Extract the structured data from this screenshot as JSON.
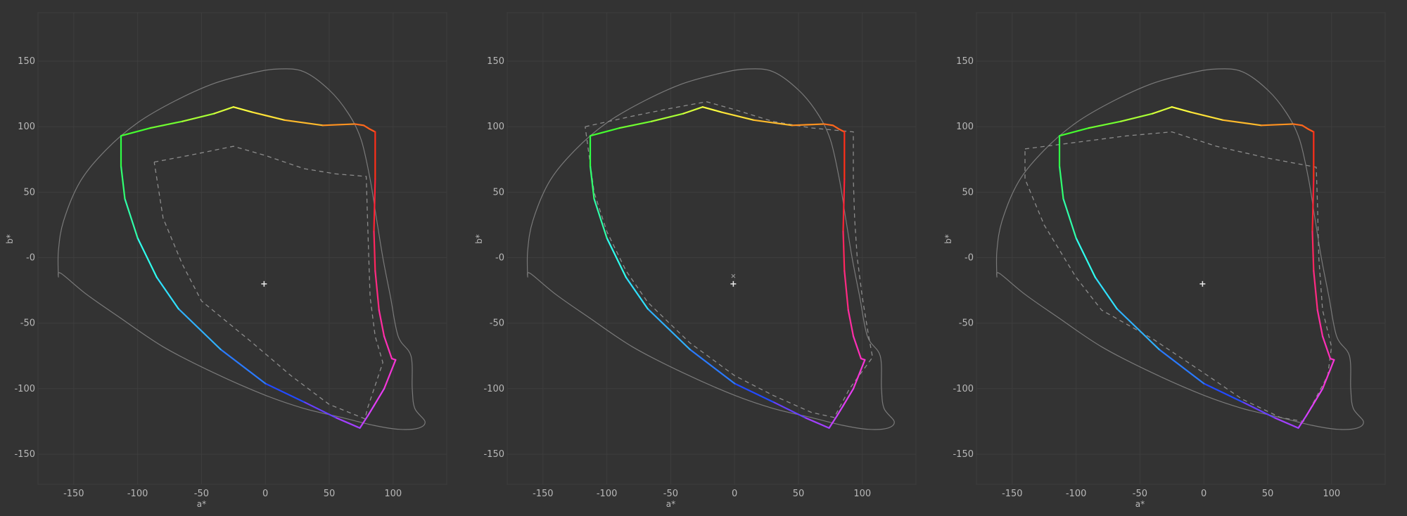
{
  "chart_data": [
    {
      "type": "line",
      "xlabel": "a*",
      "ylabel": "b*",
      "xlim": [
        -178,
        142
      ],
      "ylim": [
        -173,
        187
      ],
      "xticks": [
        -150,
        -100,
        -50,
        0,
        50,
        100
      ],
      "yticks": [
        150,
        100,
        50,
        0,
        -50,
        -100,
        -150
      ],
      "xtick_labels": [
        "-150",
        "-100",
        "-50",
        "0",
        "50",
        "100"
      ],
      "ytick_labels": [
        "150",
        "100",
        "50",
        "-0",
        "-50",
        "-100",
        "-150"
      ],
      "grid": true,
      "white_point": {
        "x": -1,
        "y": -20
      },
      "spectral_locus": [
        [
          -162,
          -15
        ],
        [
          -162,
          5
        ],
        [
          -158,
          28
        ],
        [
          -145,
          58
        ],
        [
          -125,
          82
        ],
        [
          -100,
          103
        ],
        [
          -70,
          120
        ],
        [
          -40,
          133
        ],
        [
          -10,
          141
        ],
        [
          10,
          144
        ],
        [
          30,
          142
        ],
        [
          50,
          128
        ],
        [
          65,
          110
        ],
        [
          75,
          90
        ],
        [
          82,
          60
        ],
        [
          87,
          30
        ],
        [
          92,
          0
        ],
        [
          98,
          -30
        ],
        [
          104,
          -60
        ],
        [
          114,
          -75
        ],
        [
          115,
          -100
        ],
        [
          117,
          -115
        ],
        [
          125,
          -125
        ],
        [
          120,
          -130
        ],
        [
          105,
          -131
        ],
        [
          85,
          -128
        ],
        [
          60,
          -122
        ],
        [
          30,
          -115
        ],
        [
          0,
          -105
        ],
        [
          -40,
          -88
        ],
        [
          -80,
          -68
        ],
        [
          -115,
          -45
        ],
        [
          -140,
          -28
        ],
        [
          -160,
          -12
        ],
        [
          -162,
          -15
        ]
      ],
      "gamut_boundary": [
        [
          -113,
          93
        ],
        [
          -90,
          99
        ],
        [
          -65,
          104
        ],
        [
          -40,
          110
        ],
        [
          -25,
          115
        ],
        [
          -10,
          111
        ],
        [
          15,
          105
        ],
        [
          45,
          101
        ],
        [
          70,
          102
        ],
        [
          77,
          101
        ],
        [
          82,
          98
        ],
        [
          84,
          97
        ],
        [
          86,
          96
        ],
        [
          86,
          60
        ],
        [
          85,
          20
        ],
        [
          86,
          -10
        ],
        [
          89,
          -40
        ],
        [
          93,
          -60
        ],
        [
          99,
          -77
        ],
        [
          102,
          -78
        ],
        [
          93,
          -100
        ],
        [
          85,
          -113
        ],
        [
          80,
          -121
        ],
        [
          76,
          -127
        ],
        [
          74,
          -130
        ],
        [
          55,
          -122
        ],
        [
          30,
          -110
        ],
        [
          0,
          -96
        ],
        [
          -35,
          -70
        ],
        [
          -68,
          -39
        ],
        [
          -85,
          -15
        ],
        [
          -100,
          15
        ],
        [
          -110,
          45
        ],
        [
          -113,
          70
        ],
        [
          -113,
          93
        ]
      ],
      "comparison_gamut": [
        [
          -87,
          73
        ],
        [
          -60,
          78
        ],
        [
          -25,
          85
        ],
        [
          0,
          78
        ],
        [
          30,
          68
        ],
        [
          55,
          64
        ],
        [
          79,
          62
        ],
        [
          80,
          30
        ],
        [
          81,
          0
        ],
        [
          82,
          -30
        ],
        [
          86,
          -60
        ],
        [
          92,
          -80
        ],
        [
          80,
          -115
        ],
        [
          78,
          -123
        ],
        [
          50,
          -112
        ],
        [
          20,
          -90
        ],
        [
          -10,
          -65
        ],
        [
          -50,
          -33
        ],
        [
          -65,
          -5
        ],
        [
          -80,
          30
        ],
        [
          -87,
          73
        ]
      ]
    },
    {
      "type": "line",
      "xlabel": "a*",
      "ylabel": "b*",
      "xlim": [
        -178,
        142
      ],
      "ylim": [
        -173,
        187
      ],
      "xticks": [
        -150,
        -100,
        -50,
        0,
        50,
        100
      ],
      "yticks": [
        150,
        100,
        50,
        0,
        -50,
        -100,
        -150
      ],
      "xtick_labels": [
        "-150",
        "-100",
        "-50",
        "0",
        "50",
        "100"
      ],
      "ytick_labels": [
        "150",
        "100",
        "50",
        "-0",
        "-50",
        "-100",
        "-150"
      ],
      "grid": true,
      "white_point": {
        "x": -1,
        "y": -20
      },
      "secondary_point": {
        "x": -1,
        "y": -14
      },
      "spectral_locus": [
        [
          -162,
          -15
        ],
        [
          -162,
          5
        ],
        [
          -158,
          28
        ],
        [
          -145,
          58
        ],
        [
          -125,
          82
        ],
        [
          -100,
          103
        ],
        [
          -70,
          120
        ],
        [
          -40,
          133
        ],
        [
          -10,
          141
        ],
        [
          10,
          144
        ],
        [
          30,
          142
        ],
        [
          50,
          128
        ],
        [
          65,
          110
        ],
        [
          75,
          90
        ],
        [
          82,
          60
        ],
        [
          87,
          30
        ],
        [
          92,
          0
        ],
        [
          98,
          -30
        ],
        [
          104,
          -60
        ],
        [
          114,
          -75
        ],
        [
          115,
          -100
        ],
        [
          117,
          -115
        ],
        [
          125,
          -125
        ],
        [
          120,
          -130
        ],
        [
          105,
          -131
        ],
        [
          85,
          -128
        ],
        [
          60,
          -122
        ],
        [
          30,
          -115
        ],
        [
          0,
          -105
        ],
        [
          -40,
          -88
        ],
        [
          -80,
          -68
        ],
        [
          -115,
          -45
        ],
        [
          -140,
          -28
        ],
        [
          -160,
          -12
        ],
        [
          -162,
          -15
        ]
      ],
      "gamut_boundary": [
        [
          -113,
          93
        ],
        [
          -90,
          99
        ],
        [
          -65,
          104
        ],
        [
          -40,
          110
        ],
        [
          -25,
          115
        ],
        [
          -10,
          111
        ],
        [
          15,
          105
        ],
        [
          45,
          101
        ],
        [
          70,
          102
        ],
        [
          77,
          101
        ],
        [
          82,
          98
        ],
        [
          84,
          97
        ],
        [
          86,
          96
        ],
        [
          86,
          60
        ],
        [
          85,
          20
        ],
        [
          86,
          -10
        ],
        [
          89,
          -40
        ],
        [
          93,
          -60
        ],
        [
          99,
          -77
        ],
        [
          102,
          -78
        ],
        [
          93,
          -100
        ],
        [
          85,
          -113
        ],
        [
          80,
          -121
        ],
        [
          76,
          -127
        ],
        [
          74,
          -130
        ],
        [
          55,
          -122
        ],
        [
          30,
          -110
        ],
        [
          0,
          -96
        ],
        [
          -35,
          -70
        ],
        [
          -68,
          -39
        ],
        [
          -85,
          -15
        ],
        [
          -100,
          15
        ],
        [
          -110,
          45
        ],
        [
          -113,
          70
        ],
        [
          -113,
          93
        ]
      ],
      "comparison_gamut": [
        [
          -117,
          100
        ],
        [
          -80,
          108
        ],
        [
          -50,
          114
        ],
        [
          -22,
          119
        ],
        [
          0,
          113
        ],
        [
          30,
          104
        ],
        [
          60,
          99
        ],
        [
          93,
          96
        ],
        [
          93,
          60
        ],
        [
          94,
          30
        ],
        [
          96,
          0
        ],
        [
          100,
          -30
        ],
        [
          105,
          -60
        ],
        [
          108,
          -76
        ],
        [
          90,
          -100
        ],
        [
          78,
          -122
        ],
        [
          60,
          -118
        ],
        [
          30,
          -105
        ],
        [
          0,
          -90
        ],
        [
          -35,
          -65
        ],
        [
          -68,
          -34
        ],
        [
          -85,
          -10
        ],
        [
          -100,
          20
        ],
        [
          -110,
          50
        ],
        [
          -117,
          100
        ]
      ]
    },
    {
      "type": "line",
      "xlabel": "a*",
      "ylabel": "b*",
      "xlim": [
        -178,
        142
      ],
      "ylim": [
        -173,
        187
      ],
      "xticks": [
        -150,
        -100,
        -50,
        0,
        50,
        100
      ],
      "yticks": [
        150,
        100,
        50,
        0,
        -50,
        -100,
        -150
      ],
      "xtick_labels": [
        "-150",
        "-100",
        "-50",
        "0",
        "50",
        "100"
      ],
      "ytick_labels": [
        "150",
        "100",
        "50",
        "-0",
        "-50",
        "-100",
        "-150"
      ],
      "grid": true,
      "white_point": {
        "x": -1,
        "y": -20
      },
      "spectral_locus": [
        [
          -162,
          -15
        ],
        [
          -162,
          5
        ],
        [
          -158,
          28
        ],
        [
          -145,
          58
        ],
        [
          -125,
          82
        ],
        [
          -100,
          103
        ],
        [
          -70,
          120
        ],
        [
          -40,
          133
        ],
        [
          -10,
          141
        ],
        [
          10,
          144
        ],
        [
          30,
          142
        ],
        [
          50,
          128
        ],
        [
          65,
          110
        ],
        [
          75,
          90
        ],
        [
          82,
          60
        ],
        [
          87,
          30
        ],
        [
          92,
          0
        ],
        [
          98,
          -30
        ],
        [
          104,
          -60
        ],
        [
          114,
          -75
        ],
        [
          115,
          -100
        ],
        [
          117,
          -115
        ],
        [
          125,
          -125
        ],
        [
          120,
          -130
        ],
        [
          105,
          -131
        ],
        [
          85,
          -128
        ],
        [
          60,
          -122
        ],
        [
          30,
          -115
        ],
        [
          0,
          -105
        ],
        [
          -40,
          -88
        ],
        [
          -80,
          -68
        ],
        [
          -115,
          -45
        ],
        [
          -140,
          -28
        ],
        [
          -160,
          -12
        ],
        [
          -162,
          -15
        ]
      ],
      "gamut_boundary": [
        [
          -113,
          93
        ],
        [
          -90,
          99
        ],
        [
          -65,
          104
        ],
        [
          -40,
          110
        ],
        [
          -25,
          115
        ],
        [
          -10,
          111
        ],
        [
          15,
          105
        ],
        [
          45,
          101
        ],
        [
          70,
          102
        ],
        [
          77,
          101
        ],
        [
          82,
          98
        ],
        [
          84,
          97
        ],
        [
          86,
          96
        ],
        [
          86,
          60
        ],
        [
          85,
          20
        ],
        [
          86,
          -10
        ],
        [
          89,
          -40
        ],
        [
          93,
          -60
        ],
        [
          99,
          -77
        ],
        [
          102,
          -78
        ],
        [
          93,
          -100
        ],
        [
          85,
          -113
        ],
        [
          80,
          -121
        ],
        [
          76,
          -127
        ],
        [
          74,
          -130
        ],
        [
          55,
          -122
        ],
        [
          30,
          -110
        ],
        [
          0,
          -96
        ],
        [
          -35,
          -70
        ],
        [
          -68,
          -39
        ],
        [
          -85,
          -15
        ],
        [
          -100,
          15
        ],
        [
          -110,
          45
        ],
        [
          -113,
          70
        ],
        [
          -113,
          93
        ]
      ],
      "comparison_gamut": [
        [
          -140,
          83
        ],
        [
          -100,
          88
        ],
        [
          -60,
          93
        ],
        [
          -25,
          96
        ],
        [
          10,
          85
        ],
        [
          50,
          76
        ],
        [
          88,
          69
        ],
        [
          89,
          40
        ],
        [
          90,
          0
        ],
        [
          93,
          -40
        ],
        [
          100,
          -68
        ],
        [
          97,
          -90
        ],
        [
          78,
          -125
        ],
        [
          60,
          -122
        ],
        [
          30,
          -108
        ],
        [
          0,
          -88
        ],
        [
          -40,
          -62
        ],
        [
          -80,
          -40
        ],
        [
          -100,
          -15
        ],
        [
          -125,
          25
        ],
        [
          -140,
          60
        ],
        [
          -140,
          83
        ]
      ]
    }
  ],
  "colors": {
    "background": "#333333",
    "grid": "#3e3e3e",
    "tick_text": "#b8b8b8",
    "spectral_locus": "#7a7a7a",
    "comparison_gamut": "#8c8c8c",
    "white_point": "#e8e8e8",
    "hue_gradient": [
      {
        "at": 0.0,
        "color": "#30ff30"
      },
      {
        "at": 0.06,
        "color": "#80ff30"
      },
      {
        "at": 0.13,
        "color": "#ffff40"
      },
      {
        "at": 0.23,
        "color": "#ff9020"
      },
      {
        "at": 0.29,
        "color": "#ff3018"
      },
      {
        "at": 0.32,
        "color": "#ff2020"
      },
      {
        "at": 0.5,
        "color": "#ff30c0"
      },
      {
        "at": 0.56,
        "color": "#e040ff"
      },
      {
        "at": 0.62,
        "color": "#8040ff"
      },
      {
        "at": 0.66,
        "color": "#2040ff"
      },
      {
        "at": 0.76,
        "color": "#30a0ff"
      },
      {
        "at": 0.86,
        "color": "#30ffff"
      },
      {
        "at": 0.93,
        "color": "#30ff90"
      },
      {
        "at": 1.0,
        "color": "#30ff30"
      }
    ]
  }
}
